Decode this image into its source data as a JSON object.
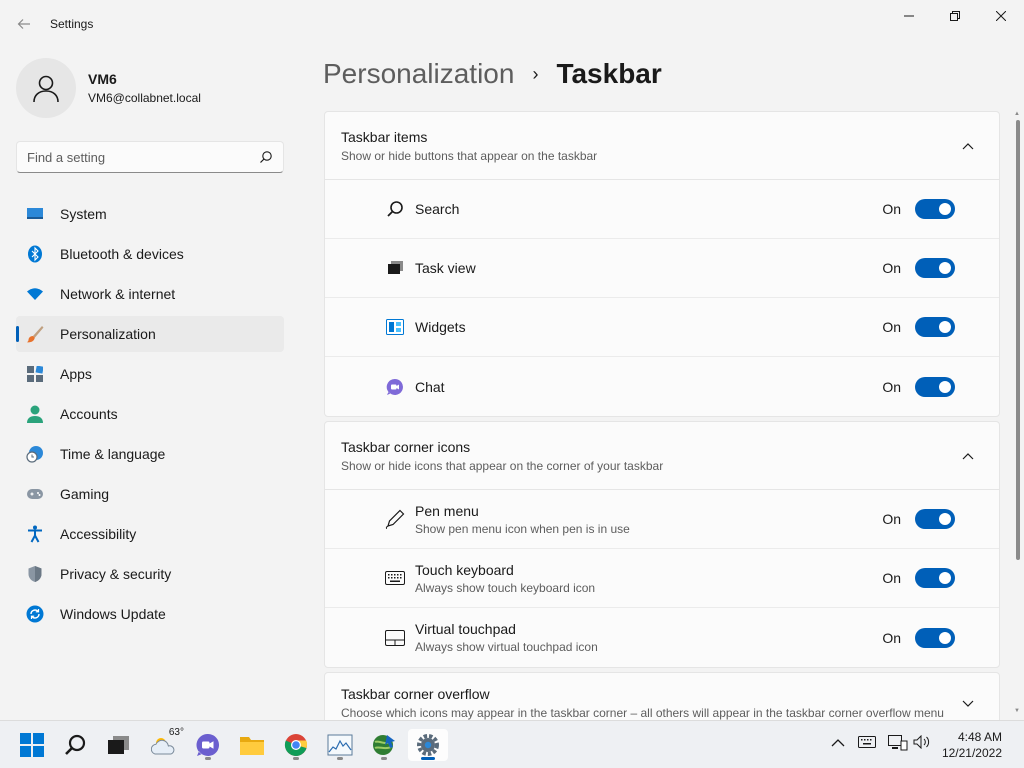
{
  "window": {
    "title": "Settings",
    "back_icon": "arrow-left-icon",
    "controls": [
      "minimize",
      "maximize",
      "close"
    ]
  },
  "profile": {
    "name": "VM6",
    "email": "VM6@collabnet.local"
  },
  "search": {
    "placeholder": "Find a setting"
  },
  "nav": {
    "items": [
      {
        "label": "System",
        "icon": "system-icon"
      },
      {
        "label": "Bluetooth & devices",
        "icon": "bluetooth-icon"
      },
      {
        "label": "Network & internet",
        "icon": "wifi-icon"
      },
      {
        "label": "Personalization",
        "icon": "brush-icon",
        "active": true
      },
      {
        "label": "Apps",
        "icon": "apps-icon"
      },
      {
        "label": "Accounts",
        "icon": "accounts-icon"
      },
      {
        "label": "Time & language",
        "icon": "clock-globe-icon"
      },
      {
        "label": "Gaming",
        "icon": "gamepad-icon"
      },
      {
        "label": "Accessibility",
        "icon": "accessibility-icon"
      },
      {
        "label": "Privacy & security",
        "icon": "shield-icon"
      },
      {
        "label": "Windows Update",
        "icon": "update-icon"
      }
    ]
  },
  "header": {
    "parent": "Personalization",
    "separator": "›",
    "current": "Taskbar"
  },
  "sections": {
    "taskbar_items": {
      "title": "Taskbar items",
      "subtitle": "Show or hide buttons that appear on the taskbar",
      "rows": [
        {
          "label": "Search",
          "state": "On",
          "icon": "search-icon"
        },
        {
          "label": "Task view",
          "state": "On",
          "icon": "task-view-icon"
        },
        {
          "label": "Widgets",
          "state": "On",
          "icon": "widgets-icon"
        },
        {
          "label": "Chat",
          "state": "On",
          "icon": "chat-icon"
        }
      ]
    },
    "corner_icons": {
      "title": "Taskbar corner icons",
      "subtitle": "Show or hide icons that appear on the corner of your taskbar",
      "rows": [
        {
          "label": "Pen menu",
          "desc": "Show pen menu icon when pen is in use",
          "state": "On",
          "icon": "pen-icon"
        },
        {
          "label": "Touch keyboard",
          "desc": "Always show touch keyboard icon",
          "state": "On",
          "icon": "keyboard-icon"
        },
        {
          "label": "Virtual touchpad",
          "desc": "Always show virtual touchpad icon",
          "state": "On",
          "icon": "touchpad-icon"
        }
      ]
    },
    "corner_overflow": {
      "title": "Taskbar corner overflow",
      "subtitle": "Choose which icons may appear in the taskbar corner – all others will appear in the taskbar corner overflow menu"
    }
  },
  "taskbar": {
    "weather_temp": "63°",
    "time": "4:48 AM",
    "date": "12/21/2022"
  },
  "colors": {
    "accent": "#005fb8",
    "background": "#f3f3f3",
    "card": "#fbfbfb"
  }
}
